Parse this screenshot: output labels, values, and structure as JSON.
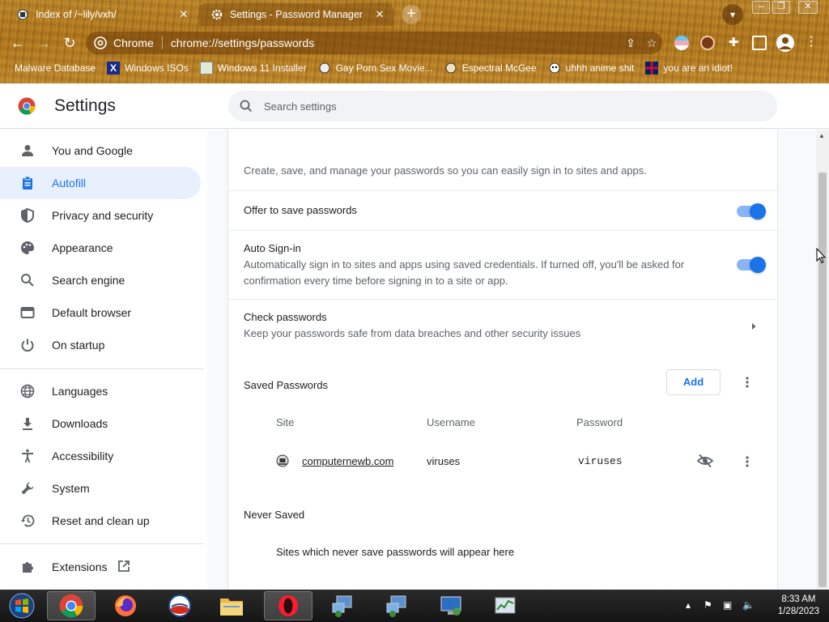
{
  "tabs": [
    {
      "title": "Index of /~lily/vxh/",
      "close": "✕"
    },
    {
      "title": "Settings - Password Manager",
      "close": "✕"
    }
  ],
  "new_tab_label": "+",
  "omnibox": {
    "chip": "Chrome",
    "url": "chrome://settings/passwords"
  },
  "bookmarks": [
    {
      "label": "Malware Database"
    },
    {
      "label": "Windows ISOs"
    },
    {
      "label": "Windows 11 Installer"
    },
    {
      "label": "Gay Porn Sex Movie..."
    },
    {
      "label": "Espectral McGee"
    },
    {
      "label": "uhhh anime shit"
    },
    {
      "label": "you are an idiot!"
    }
  ],
  "header": {
    "title": "Settings",
    "search_placeholder": "Search settings"
  },
  "sidebar": {
    "items": [
      {
        "label": "You and Google",
        "icon": "person-icon"
      },
      {
        "label": "Autofill",
        "icon": "clipboard-icon",
        "active": true
      },
      {
        "label": "Privacy and security",
        "icon": "shield-icon"
      },
      {
        "label": "Appearance",
        "icon": "palette-icon"
      },
      {
        "label": "Search engine",
        "icon": "search-icon"
      },
      {
        "label": "Default browser",
        "icon": "browser-icon"
      },
      {
        "label": "On startup",
        "icon": "power-icon"
      },
      {
        "label": "Languages",
        "icon": "globe-icon"
      },
      {
        "label": "Downloads",
        "icon": "download-icon"
      },
      {
        "label": "Accessibility",
        "icon": "accessibility-icon"
      },
      {
        "label": "System",
        "icon": "wrench-icon"
      },
      {
        "label": "Reset and clean up",
        "icon": "history-icon"
      },
      {
        "label": "Extensions",
        "icon": "puzzle-icon"
      }
    ]
  },
  "main": {
    "intro": "Create, save, and manage your passwords so you can easily sign in to sites and apps.",
    "offer_to_save": {
      "label": "Offer to save passwords",
      "enabled": true
    },
    "auto_signin": {
      "label": "Auto Sign-in",
      "description_line1": "Automatically sign in to sites and apps using saved credentials. If turned off, you'll be asked for",
      "description_line2": "confirmation every time before signing in to a site or app.",
      "enabled": true
    },
    "check_passwords": {
      "label": "Check passwords",
      "description": "Keep your passwords safe from data breaches and other security issues"
    },
    "saved_passwords": {
      "heading": "Saved Passwords",
      "add_label": "Add",
      "columns": [
        "Site",
        "Username",
        "Password"
      ],
      "rows": [
        {
          "site": "computernewb.com",
          "username": "viruses",
          "password": "viruses"
        }
      ]
    },
    "never_saved": {
      "heading": "Never Saved",
      "empty_text": "Sites which never save passwords will appear here"
    }
  },
  "taskbar": {
    "time": "8:33 AM",
    "date": "1/28/2023"
  },
  "colors": {
    "accent": "#1a73e8",
    "active_nav_bg": "#e8f0fe"
  }
}
